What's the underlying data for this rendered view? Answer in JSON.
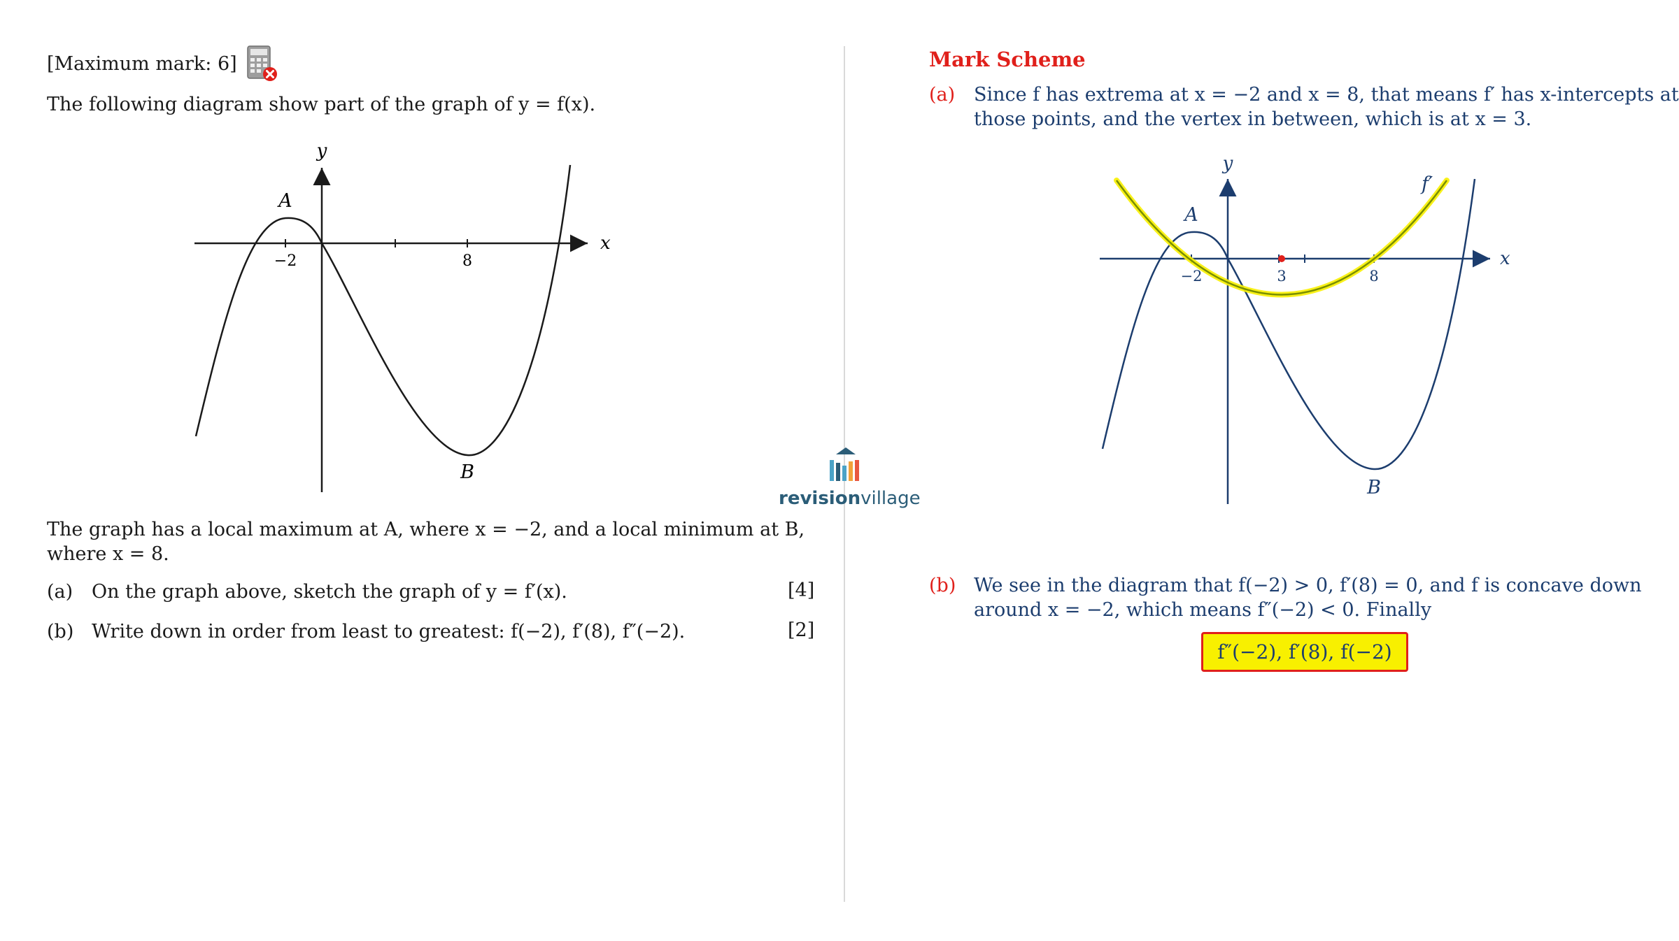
{
  "question": {
    "max_mark": "[Maximum mark: 6]",
    "calculator_icon": "calculator-disallowed-icon",
    "intro": "The following diagram show part of the graph of y = f(x).",
    "description_line1": "The graph has a local maximum at A, where x = −2, and a local minimum at B,",
    "description_line2": "where x = 8.",
    "parts": [
      {
        "label": "(a)",
        "text": "On the graph above, sketch the graph of y = f′(x).",
        "marks": "[4]"
      },
      {
        "label": "(b)",
        "text": "Write down in order from least to greatest: f(−2), f′(8), f″(−2).",
        "marks": "[2]"
      }
    ],
    "graph": {
      "x_axis_label": "x",
      "y_axis_label": "y",
      "tick_labels": [
        "−2",
        "8"
      ],
      "point_labels": {
        "max": "A",
        "min": "B"
      }
    }
  },
  "logo": {
    "text_bold": "revision",
    "text_light": "village"
  },
  "mark_scheme": {
    "title": "Mark Scheme",
    "part_a": {
      "label": "(a)",
      "line1": "Since f has extrema at x = −2 and x = 8, that means f′ has x-intercepts at",
      "line2": "those points, and the vertex in between, which is at x = 3."
    },
    "graph": {
      "x_axis_label": "x",
      "y_axis_label": "y",
      "tick_labels": [
        "−2",
        "3",
        "8"
      ],
      "point_labels": {
        "max": "A",
        "min": "B"
      },
      "derivative_label": "f′"
    },
    "part_b": {
      "label": "(b)",
      "line1": "We see in the diagram that f(−2) > 0, f′(8) = 0, and f is concave down",
      "line2": "around x = −2, which means f″(−2) < 0. Finally",
      "answer": "f″(−2), f′(8), f(−2)"
    },
    "colors": {
      "accent": "#e0201b",
      "text": "#1c3d6e",
      "highlight": "#f8f000",
      "derivative_curve": "#7a8f00"
    }
  }
}
